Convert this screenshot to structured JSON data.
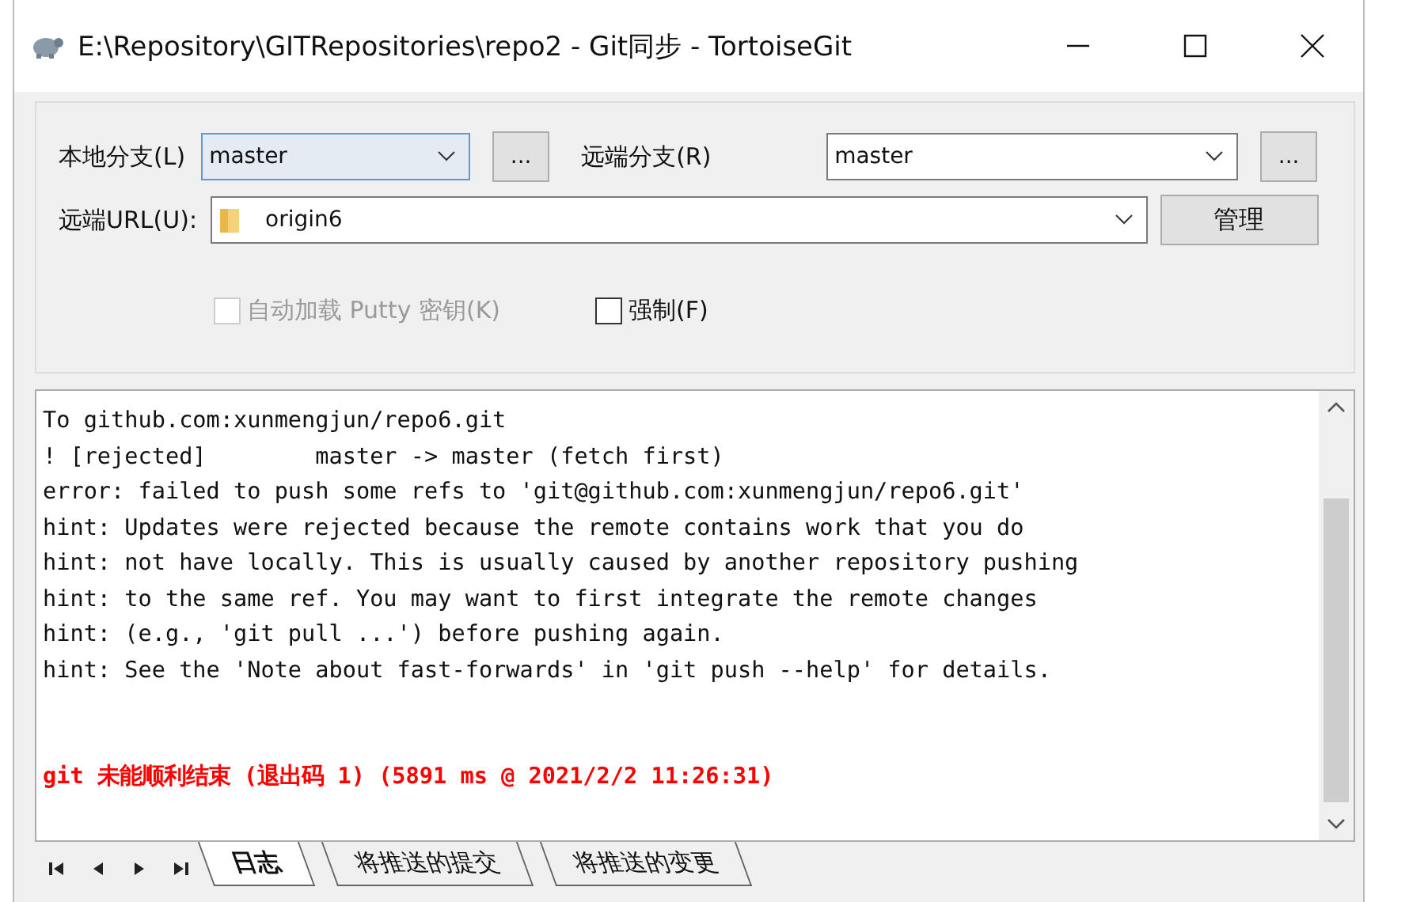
{
  "window": {
    "title": "E:\\Repository\\GITRepositories\\repo2 - Git同步 - TortoiseGit"
  },
  "local_branch": {
    "label": "本地分支(L)",
    "value": "master",
    "browse": "..."
  },
  "remote_branch": {
    "label": "远端分支(R)",
    "value": "master",
    "browse": "..."
  },
  "remote_url": {
    "label": "远端URL(U):",
    "value": "origin6",
    "manage": "管理"
  },
  "options": [
    {
      "label": "自动加载 Putty 密钥(K)",
      "checked": false,
      "disabled": true
    },
    {
      "label": "强制(F)",
      "checked": false,
      "disabled": false
    }
  ],
  "log": [
    {
      "kind": "normal",
      "text": "To github.com:xunmengjun/repo6.git"
    },
    {
      "kind": "normal",
      "text": "! [rejected]        master -> master (fetch first)"
    },
    {
      "kind": "normal",
      "text": "error: failed to push some refs to 'git@github.com:xunmengjun/repo6.git'"
    },
    {
      "kind": "normal",
      "text": "hint: Updates were rejected because the remote contains work that you do"
    },
    {
      "kind": "normal",
      "text": "hint: not have locally. This is usually caused by another repository pushing"
    },
    {
      "kind": "normal",
      "text": "hint: to the same ref. You may want to first integrate the remote changes"
    },
    {
      "kind": "normal",
      "text": "hint: (e.g., 'git pull ...') before pushing again."
    },
    {
      "kind": "normal",
      "text": "hint: See the 'Note about fast-forwards' in 'git push --help' for details."
    },
    {
      "kind": "blank"
    },
    {
      "kind": "blank"
    },
    {
      "kind": "error",
      "text": "git 未能顺利结束 (退出码 1) (5891 ms @ 2021/2/2 11:26:31)"
    }
  ],
  "tabs": [
    {
      "label": "日志",
      "selected": true
    },
    {
      "label": "将推送的提交",
      "selected": false
    },
    {
      "label": "将推送的变更",
      "selected": false
    }
  ]
}
